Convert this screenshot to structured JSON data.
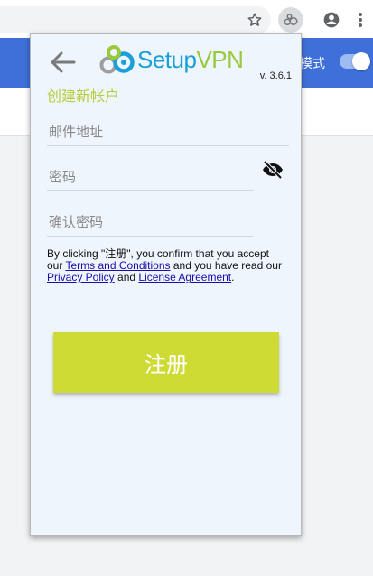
{
  "browser": {
    "star_icon": "star-icon",
    "extension_icon": "setupvpn-extension-icon",
    "account_icon": "account-icon",
    "menu_icon": "more-vert-icon"
  },
  "page": {
    "mode_label": "模式"
  },
  "popup": {
    "logo": {
      "part1": "Setup",
      "part2": "VPN"
    },
    "version": "v. 3.6.1",
    "title": "创建新帐户",
    "email_placeholder": "邮件地址",
    "password_placeholder": "密码",
    "confirm_placeholder": "确认密码",
    "terms": {
      "prefix": "By clicking \"注册\", you confirm that you accept our ",
      "terms_link": "Terms and Conditions",
      "middle": " and you have read our ",
      "privacy_link": "Privacy Policy",
      "and": " and ",
      "license_link": "License Agreement",
      "suffix": "."
    },
    "signup_label": "注册"
  },
  "colors": {
    "header_blue": "#3f6fd8",
    "title_green": "#b8cd3c",
    "button_green": "#cfdb35",
    "logo_blue": "#1aa0d8",
    "logo_green": "#9bc93d"
  }
}
